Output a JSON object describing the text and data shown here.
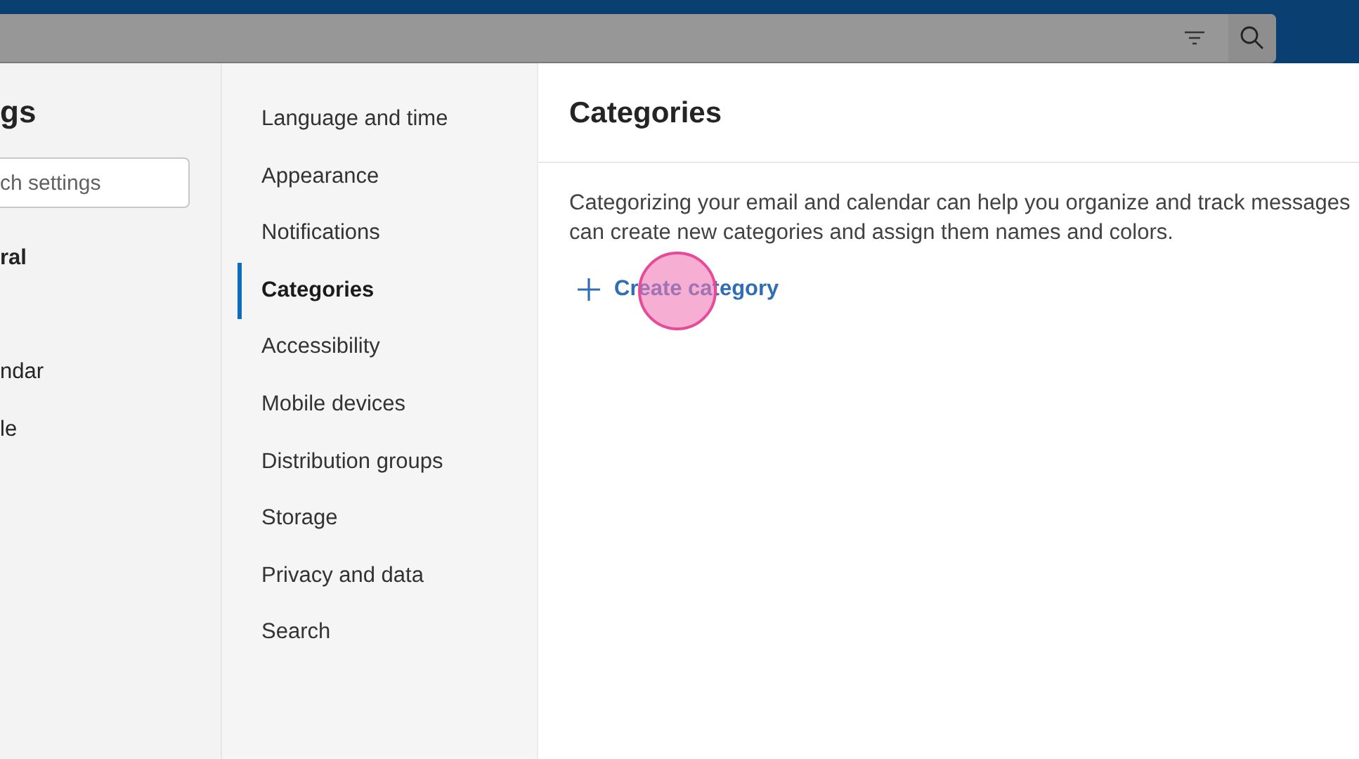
{
  "settings_pane": {
    "title": "gs",
    "search": {
      "placeholder": "ch settings"
    },
    "items": [
      {
        "label": "ral",
        "selected": true
      },
      {
        "label": "ndar",
        "selected": false
      },
      {
        "label": "le",
        "selected": false
      }
    ]
  },
  "nav": [
    {
      "label": "Language and time",
      "selected": false
    },
    {
      "label": "Appearance",
      "selected": false
    },
    {
      "label": "Notifications",
      "selected": false
    },
    {
      "label": "Categories",
      "selected": true
    },
    {
      "label": "Accessibility",
      "selected": false
    },
    {
      "label": "Mobile devices",
      "selected": false
    },
    {
      "label": "Distribution groups",
      "selected": false
    },
    {
      "label": "Storage",
      "selected": false
    },
    {
      "label": "Privacy and data",
      "selected": false
    },
    {
      "label": "Search",
      "selected": false
    }
  ],
  "content": {
    "title": "Categories",
    "description_lines": [
      "Categorizing your email and calendar can help you organize and track messages",
      "can create new categories and assign them names and colors."
    ],
    "create_button": {
      "label": "Create category"
    }
  }
}
